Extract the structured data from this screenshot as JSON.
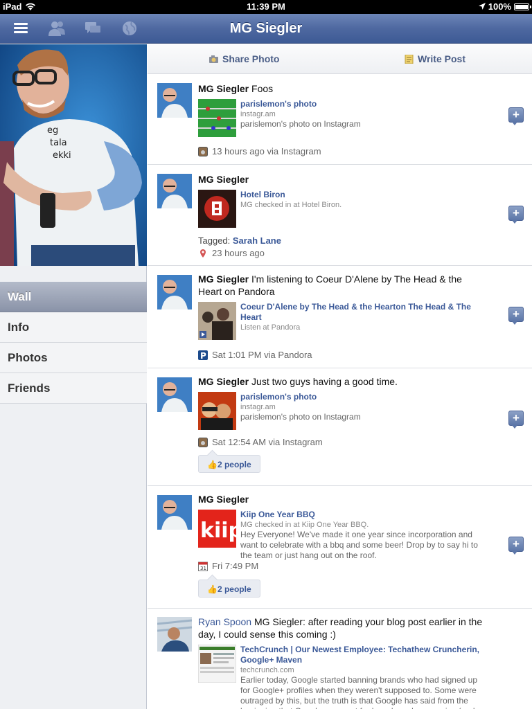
{
  "status_bar": {
    "carrier": "iPad",
    "time": "11:39 PM",
    "battery": "100%"
  },
  "nav": {
    "title": "MG Siegler"
  },
  "sidebar": {
    "items": [
      {
        "label": "Wall",
        "active": true
      },
      {
        "label": "Info",
        "active": false
      },
      {
        "label": "Photos",
        "active": false
      },
      {
        "label": "Friends",
        "active": false
      }
    ]
  },
  "actions": {
    "share_photo": "Share Photo",
    "write_post": "Write Post"
  },
  "posts": [
    {
      "author": "MG Siegler",
      "text": "Foos",
      "attachment": {
        "title": "parislemon's photo",
        "meta": "instagr.am",
        "desc": "parislemon's photo on Instagram"
      },
      "stamp": "13 hours ago via Instagram",
      "stamp_icon": "instagram-icon"
    },
    {
      "author": "MG Siegler",
      "text": "",
      "attachment": {
        "title": "Hotel Biron",
        "meta": "MG checked in at Hotel Biron.",
        "desc": ""
      },
      "tagged_label": "Tagged:",
      "tagged_name": "Sarah Lane",
      "stamp": "23 hours ago",
      "stamp_icon": "location-pin-icon"
    },
    {
      "author": "MG Siegler",
      "text": "I'm listening to Coeur D'Alene by The Head & the Heart on Pandora",
      "attachment": {
        "title": "Coeur D'Alene by The Head & the Hearton The Head & The Heart",
        "meta": "Listen at Pandora",
        "desc": ""
      },
      "stamp": "Sat 1:01 PM via Pandora",
      "stamp_icon": "pandora-icon"
    },
    {
      "author": "MG Siegler",
      "text": "Just two guys having a good time.",
      "attachment": {
        "title": "parislemon's photo",
        "meta": "instagr.am",
        "desc": "parislemon's photo on Instagram"
      },
      "stamp": "Sat 12:54 AM via Instagram",
      "stamp_icon": "instagram-icon",
      "likes": "2 people"
    },
    {
      "author": "MG Siegler",
      "text": "",
      "attachment": {
        "title": "Kiip One Year BBQ",
        "meta": "MG checked in at Kiip One Year BBQ.",
        "desc": "Hey Everyone! We've made it one year since incorporation and want to celebrate with a bbq and some beer! Drop by to say hi to the team or just hang out on the roof."
      },
      "stamp": "Fri 7:49 PM",
      "stamp_icon": "calendar-icon",
      "likes": "2 people"
    },
    {
      "author": "Ryan Spoon",
      "text": "MG Siegler: after reading your blog post earlier in the day, I could sense this coming :)",
      "attachment": {
        "title": "TechCrunch | Our Newest Employee: Techathew Cruncherin, Google+ Maven",
        "meta": "techcrunch.com",
        "desc": "Earlier today, Google started banning brands who had signed up for Google+ profiles when they weren't supposed to. Some were outraged by this, but the truth is that Google has said from the beginning that Google+ was not for brands and companies (and that"
      }
    }
  ],
  "colors": {
    "nav_blue": "#4e68a0",
    "link_blue": "#3b5998"
  }
}
